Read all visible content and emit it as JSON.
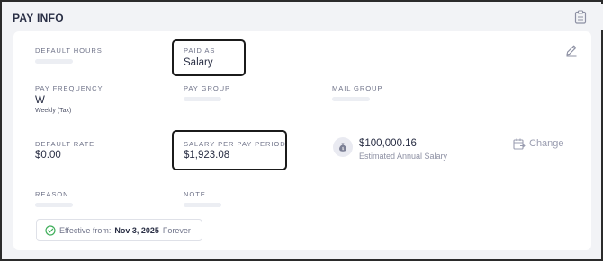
{
  "header": {
    "title": "PAY INFO",
    "icon": "clipboard-icon"
  },
  "fields": {
    "default_hours": {
      "label": "DEFAULT HOURS"
    },
    "paid_as": {
      "label": "PAID AS",
      "value": "Salary"
    },
    "pay_frequency": {
      "label": "PAY FREQUENCY",
      "value": "W",
      "sub": "Weekly (Tax)"
    },
    "pay_group": {
      "label": "PAY GROUP"
    },
    "mail_group": {
      "label": "MAIL GROUP"
    },
    "default_rate": {
      "label": "DEFAULT RATE",
      "value": "$0.00"
    },
    "salary_per_period": {
      "label": "SALARY PER PAY PERIOD",
      "value": "$1,923.08"
    },
    "reason": {
      "label": "REASON"
    },
    "note": {
      "label": "NOTE"
    }
  },
  "annual": {
    "value": "$100,000.16",
    "caption": "Estimated Annual Salary",
    "icon": "money-bag-icon"
  },
  "change_button": {
    "label": "Change",
    "icon": "change-icon"
  },
  "edit_button": {
    "icon": "pencil-icon"
  },
  "effective": {
    "prefix": "Effective from:",
    "date": "Nov 3, 2025",
    "suffix": "Forever",
    "icon": "check-circle-icon"
  },
  "colors": {
    "text": "#2a2f45",
    "muted": "#6f7389",
    "success": "#3fae5a",
    "background": "#f2f3f6"
  }
}
